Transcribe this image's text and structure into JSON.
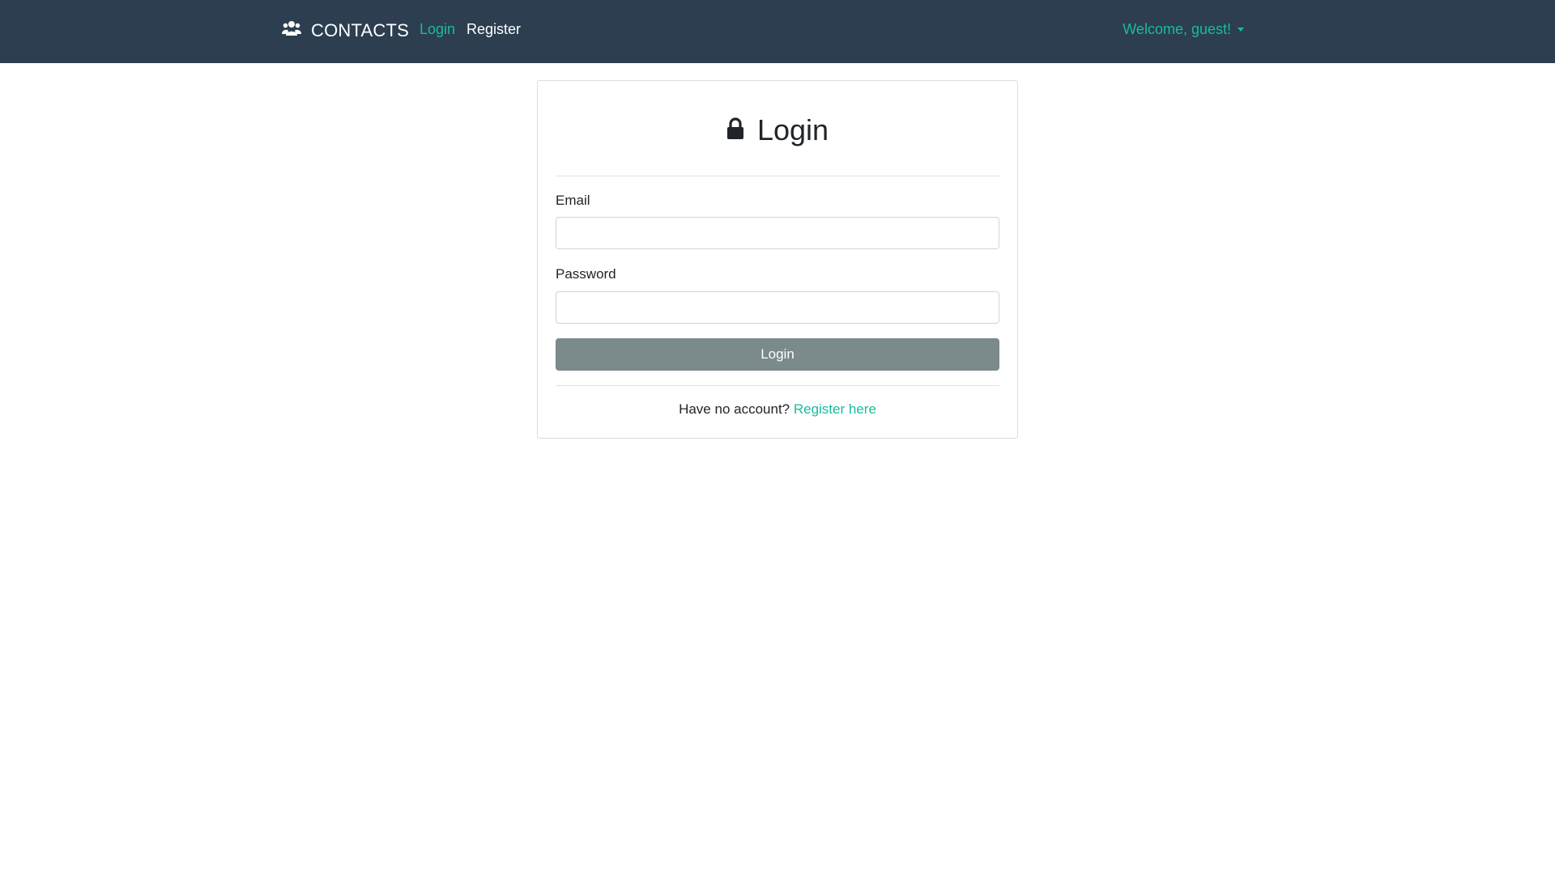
{
  "colors": {
    "navbar_bg": "#2c3e50",
    "accent": "#18bc9c",
    "button_bg": "#7b8a8b"
  },
  "navbar": {
    "brand_icon": "users-icon",
    "brand": "CONTACTS",
    "links": [
      {
        "label": "Login",
        "active": true
      },
      {
        "label": "Register",
        "active": false
      }
    ],
    "welcome": "Welcome, guest!"
  },
  "card": {
    "title_icon": "lock-icon",
    "title": "Login",
    "email_label": "Email",
    "email_value": "",
    "password_label": "Password",
    "password_value": "",
    "submit_label": "Login",
    "footer_text": "Have no account?",
    "footer_link": "Register here"
  }
}
